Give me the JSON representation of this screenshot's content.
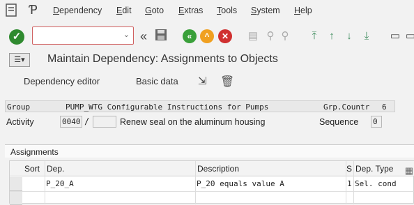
{
  "menu": {
    "items": [
      "Dependency",
      "Edit",
      "Goto",
      "Extras",
      "Tools",
      "System",
      "Help"
    ]
  },
  "toolbar": {
    "command_value": "",
    "icons": [
      "check-icon",
      "back-double-icon",
      "save-icon",
      "back-icon",
      "exit-icon",
      "cancel-icon",
      "print-icon",
      "find-icon",
      "find-next-icon",
      "first-page-icon",
      "prev-page-icon",
      "next-page-icon",
      "last-page-icon",
      "layout-icon"
    ]
  },
  "title": "Maintain Dependency: Assignments to Objects",
  "app_toolbar": {
    "dependency_editor": "Dependency editor",
    "basic_data": "Basic data"
  },
  "header": {
    "group_label": "Group",
    "group_value": "PUMP_WTG Configurable Instructions for Pumps",
    "grp_counter_label": "Grp.Countr",
    "grp_counter_value": "6",
    "activity_label": "Activity",
    "activity_value": "0040",
    "activity_sep": "/",
    "activity_text": "Renew seal on the aluminum housing",
    "sequence_label": "Sequence",
    "sequence_value": "0"
  },
  "assignments": {
    "title": "Assignments",
    "columns": [
      "Sort",
      "Dep.",
      "Description",
      "S",
      "Dep. Type"
    ],
    "rows": [
      {
        "sort": "",
        "dep": "P_20_A",
        "description": "P_20 equals value A",
        "s": "1",
        "dep_type": "Sel. cond"
      }
    ]
  },
  "colors": {
    "ok_green": "#2f8a2f",
    "back_green": "#3aa03a",
    "exit_orange": "#f0a020",
    "cancel_red": "#d03030"
  }
}
